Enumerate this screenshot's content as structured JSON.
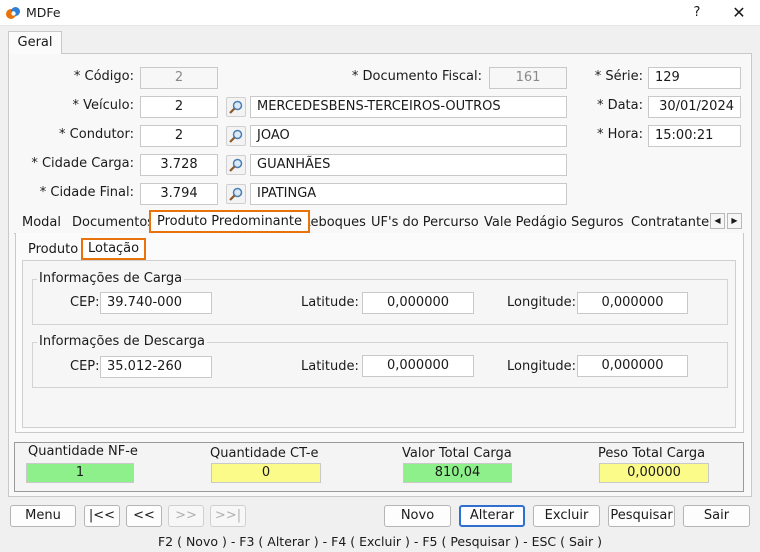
{
  "window": {
    "title": "MDFe",
    "help": "?",
    "close": "✕"
  },
  "main_tab": "Geral",
  "form": {
    "codigo": {
      "label": "* Código:",
      "value": "2"
    },
    "documento_fiscal": {
      "label": "* Documento Fiscal:",
      "value": "161"
    },
    "serie": {
      "label": "* Série:",
      "value": "129"
    },
    "veiculo": {
      "label": "* Veículo:",
      "code": "2",
      "name": "MERCEDESBENS-TERCEIROS-OUTROS"
    },
    "data": {
      "label": "* Data:",
      "value": "30/01/2024"
    },
    "condutor": {
      "label": "* Condutor:",
      "code": "2",
      "name": "JOAO"
    },
    "hora": {
      "label": "* Hora:",
      "value": "15:00:21"
    },
    "cidade_carga": {
      "label": "* Cidade Carga:",
      "code": "3.728",
      "name": "GUANHÃES"
    },
    "cidade_final": {
      "label": "* Cidade Final:",
      "code": "3.794",
      "name": "IPATINGA"
    }
  },
  "tabs": [
    "Modal",
    "Documentos",
    "Produto Predominante",
    "Reboques",
    "UF's do Percurso",
    "Vale Pedágio",
    "Seguros",
    "Contratantes"
  ],
  "subtabs": [
    "Produto",
    "Lotação"
  ],
  "carga": {
    "title": "Informações de Carga",
    "cep_label": "CEP:",
    "cep": "39.740-000",
    "lat_label": "Latitude:",
    "lat": "0,000000",
    "lon_label": "Longitude:",
    "lon": "0,000000"
  },
  "descarga": {
    "title": "Informações de Descarga",
    "cep_label": "CEP:",
    "cep": "35.012-260",
    "lat_label": "Latitude:",
    "lat": "0,000000",
    "lon_label": "Longitude:",
    "lon": "0,000000"
  },
  "totals": {
    "nfe": {
      "label": "Quantidade NF-e",
      "value": "1"
    },
    "cte": {
      "label": "Quantidade CT-e",
      "value": "0"
    },
    "valor": {
      "label": "Valor Total Carga",
      "value": "810,04"
    },
    "peso": {
      "label": "Peso Total Carga",
      "value": "0,00000"
    }
  },
  "buttons": {
    "menu": "Menu",
    "first": "|<<",
    "prev": "<<",
    "next": ">>",
    "last": ">>|",
    "novo": "Novo",
    "alterar": "Alterar",
    "excluir": "Excluir",
    "pesquisar": "Pesquisar",
    "sair": "Sair"
  },
  "shortcuts": "F2 ( Novo )  -  F3 ( Alterar )  -  F4 ( Excluir )  -  F5 ( Pesquisar )  -  ESC ( Sair )",
  "colors": {
    "accent": "#e8730c",
    "focus": "#2f6fcf",
    "green": "#8ef08a",
    "yellow": "#fbfb8a"
  }
}
